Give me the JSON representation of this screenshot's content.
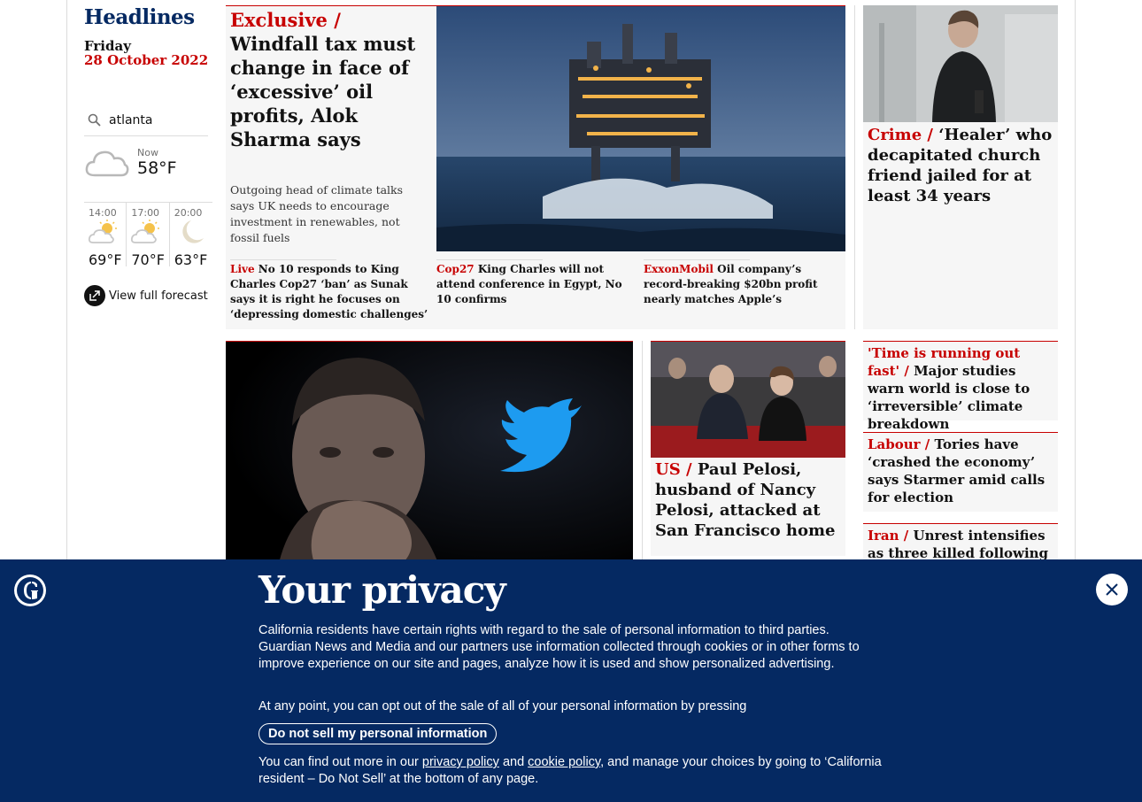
{
  "sidebar": {
    "title": "Headlines",
    "day": "Friday",
    "date": "28 October 2022",
    "search_value": "atlanta",
    "now_label": "Now",
    "now_temp": "58°F",
    "forecast": [
      {
        "time": "14:00",
        "temp": "69°F",
        "icon": "partly-sunny-icon"
      },
      {
        "time": "17:00",
        "temp": "70°F",
        "icon": "partly-sunny-icon"
      },
      {
        "time": "20:00",
        "temp": "63°F",
        "icon": "moon-icon"
      }
    ],
    "full_forecast_label": "View full forecast"
  },
  "main_story": {
    "kicker": "Exclusive /",
    "headline": "Windfall tax must change in face of ‘excessive’ oil profits, Alok Sharma says",
    "standfirst": "Outgoing head of climate talks says UK needs to encourage investment in renewables, not fossil fuels",
    "subs": [
      {
        "kicker": "Live",
        "text": "No 10 responds to King Charles Cop27 ‘ban’ as Sunak says it is right he focuses on ‘depressing domestic challenges’"
      },
      {
        "kicker": "Cop27",
        "text": "King Charles will not attend conference in Egypt, No 10 confirms"
      },
      {
        "kicker": "ExxonMobil",
        "text": "Oil company’s record-breaking $20bn profit nearly matches Apple’s"
      }
    ]
  },
  "right_top": {
    "kicker": "Crime /",
    "headline": "‘Healer’ who decapitated church friend jailed for at least 34 years"
  },
  "pelosi": {
    "kicker": "US /",
    "headline": "Paul Pelosi, husband of Nancy Pelosi, attacked at San Francisco home"
  },
  "small_cards": [
    {
      "kicker": "'Time is running out fast' /",
      "headline": "Major studies warn world is close to ‘irreversible’ climate breakdown"
    },
    {
      "kicker": "Labour /",
      "headline": "Tories have ‘crashed the economy’ says Starmer amid calls for election"
    },
    {
      "kicker": "Iran /",
      "headline": "Unrest intensifies as three killed following"
    }
  ],
  "privacy": {
    "title": "Your privacy",
    "p1": "California residents have certain rights with regard to the sale of personal information to third parties. Guardian News and Media and our partners use information collected through cookies or in other forms to improve experience on our site and pages, analyze how it is used and show personalized advertising.",
    "p2": "At any point, you can opt out of the sale of all of your personal information by pressing",
    "button": "Do not sell my personal information",
    "p3_a": "You can find out more in our",
    "link1": "privacy policy",
    "p3_b": "and",
    "link2": "cookie policy",
    "p3_c": ", and manage your choices by going to ‘California resident – Do Not Sell’ at the bottom of any page."
  }
}
